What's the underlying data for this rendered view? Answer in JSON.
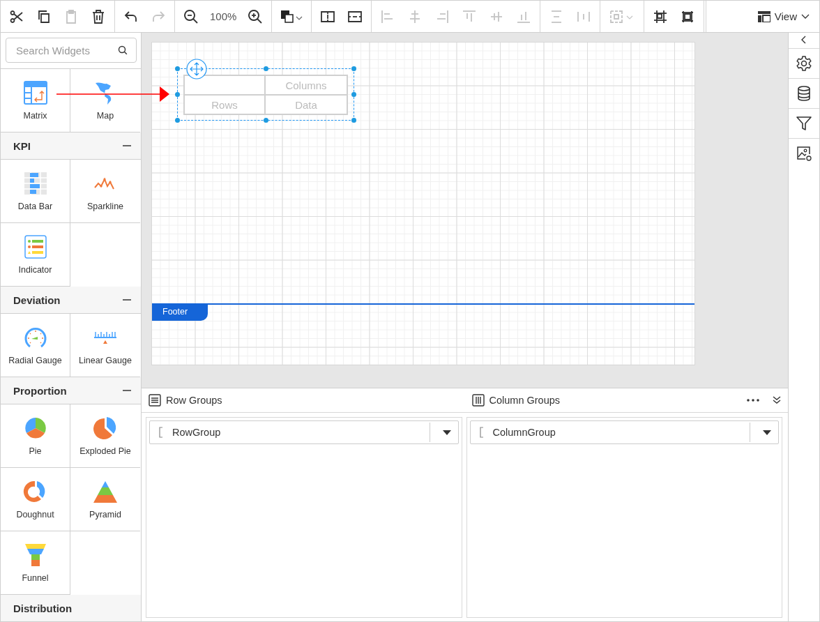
{
  "toolbar": {
    "groups": [
      {
        "items": [
          {
            "kind": "cut",
            "disabled": false
          },
          {
            "kind": "copy",
            "disabled": false
          },
          {
            "kind": "paste",
            "disabled": true
          },
          {
            "kind": "delete",
            "disabled": false
          }
        ]
      },
      {
        "items": [
          {
            "kind": "undo",
            "disabled": false
          },
          {
            "kind": "redo",
            "disabled": true
          }
        ]
      },
      {
        "items": [
          {
            "kind": "zoom-out",
            "disabled": false
          },
          {
            "kind": "zoom-level",
            "text": "100%"
          },
          {
            "kind": "zoom-in",
            "disabled": false
          }
        ]
      },
      {
        "items": [
          {
            "kind": "color",
            "disabled": false
          }
        ]
      },
      {
        "items": [
          {
            "kind": "split-vertical",
            "disabled": false
          },
          {
            "kind": "split-horizontal",
            "disabled": false
          }
        ]
      },
      {
        "items": [
          {
            "kind": "align-left",
            "disabled": true
          },
          {
            "kind": "align-center",
            "disabled": true
          },
          {
            "kind": "align-right",
            "disabled": true
          },
          {
            "kind": "align-top",
            "disabled": true
          },
          {
            "kind": "align-middle",
            "disabled": true
          },
          {
            "kind": "align-bottom",
            "disabled": true
          }
        ]
      },
      {
        "items": [
          {
            "kind": "distribute-vertical",
            "disabled": true
          },
          {
            "kind": "distribute-horizontal",
            "disabled": true
          }
        ]
      },
      {
        "items": [
          {
            "kind": "group-select",
            "disabled": true
          }
        ]
      },
      {
        "items": [
          {
            "kind": "fit-small",
            "disabled": false
          },
          {
            "kind": "fit-large",
            "disabled": false
          }
        ]
      }
    ],
    "view_button": {
      "label": "View"
    }
  },
  "sidebar": {
    "search": {
      "placeholder": "Search Widgets"
    },
    "sections": [
      {
        "widgets": [
          {
            "kind": "matrix",
            "label": "Matrix"
          },
          {
            "kind": "map",
            "label": "Map"
          }
        ]
      },
      {
        "title": "KPI",
        "expanded": true,
        "widgets": [
          {
            "kind": "databar",
            "label": "Data Bar"
          },
          {
            "kind": "sparkline",
            "label": "Sparkline"
          },
          {
            "kind": "indicator",
            "label": "Indicator"
          }
        ]
      },
      {
        "title": "Deviation",
        "expanded": true,
        "widgets": [
          {
            "kind": "radial",
            "label": "Radial Gauge"
          },
          {
            "kind": "linear",
            "label": "Linear Gauge"
          }
        ]
      },
      {
        "title": "Proportion",
        "expanded": true,
        "widgets": [
          {
            "kind": "pie",
            "label": "Pie"
          },
          {
            "kind": "exploded",
            "label": "Exploded Pie"
          },
          {
            "kind": "doughnut",
            "label": "Doughnut"
          },
          {
            "kind": "pyramid",
            "label": "Pyramid"
          },
          {
            "kind": "funnel",
            "label": "Funnel"
          }
        ]
      },
      {
        "title": "Distribution"
      }
    ]
  },
  "canvas": {
    "matrix": {
      "selected": true,
      "column_header": "Columns",
      "row_header": "Rows",
      "data": "Data"
    },
    "footer_band": {
      "label": "Footer"
    }
  },
  "groups_panel": {
    "row_groups": {
      "title": "Row Groups",
      "value": "RowGroup"
    },
    "column_groups": {
      "title": "Column Groups",
      "value": "ColumnGroup"
    }
  }
}
